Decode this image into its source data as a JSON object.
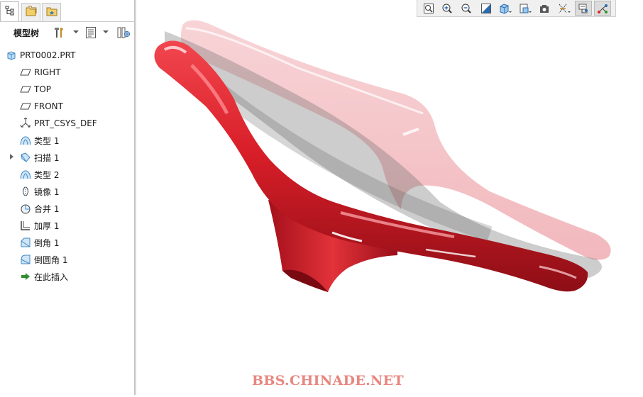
{
  "tabs": [
    {
      "icon": "model-tree-tab-icon",
      "active": true
    },
    {
      "icon": "folder-browser-tab-icon",
      "active": false
    },
    {
      "icon": "favorites-tab-icon",
      "active": false
    }
  ],
  "tree_toolbar": {
    "title": "模型树",
    "settings_icon": "settings-tools-icon",
    "show_icon": "show-list-icon",
    "columns_icon": "tree-columns-icon"
  },
  "tree": {
    "root": "PRT0002.PRT",
    "items": [
      {
        "label": "RIGHT",
        "icon": "datum-plane-icon"
      },
      {
        "label": "TOP",
        "icon": "datum-plane-icon"
      },
      {
        "label": "FRONT",
        "icon": "datum-plane-icon"
      },
      {
        "label": "PRT_CSYS_DEF",
        "icon": "coordinate-system-icon"
      },
      {
        "label": "类型 1",
        "icon": "boundary-blend-icon"
      },
      {
        "label": "扫描 1",
        "icon": "sweep-icon",
        "expandable": true
      },
      {
        "label": "类型 2",
        "icon": "boundary-blend-icon"
      },
      {
        "label": "镜像 1",
        "icon": "mirror-icon"
      },
      {
        "label": "合并 1",
        "icon": "merge-icon"
      },
      {
        "label": "加厚 1",
        "icon": "thicken-icon"
      },
      {
        "label": "倒角 1",
        "icon": "chamfer-icon"
      },
      {
        "label": "倒圆角 1",
        "icon": "round-icon"
      },
      {
        "label": "在此插入",
        "icon": "insert-here-arrow-icon"
      }
    ]
  },
  "view_toolbar": [
    {
      "name": "refit-icon"
    },
    {
      "name": "zoom-in-icon"
    },
    {
      "name": "zoom-out-icon"
    },
    {
      "name": "repaint-icon"
    },
    {
      "name": "display-style-icon",
      "dropdown": true
    },
    {
      "name": "saved-views-icon",
      "dropdown": true
    },
    {
      "name": "view-manager-icon"
    },
    {
      "name": "datum-display-icon",
      "dropdown": true
    },
    {
      "name": "annotation-display-icon",
      "pressed": true
    },
    {
      "name": "spin-center-icon",
      "pressed": true
    }
  ],
  "watermark": "BBS.CHINADE.NET",
  "colors": {
    "part_red": "#d81e28",
    "ghost_pink": "#f5c2c6",
    "watermark": "#e8867f"
  }
}
